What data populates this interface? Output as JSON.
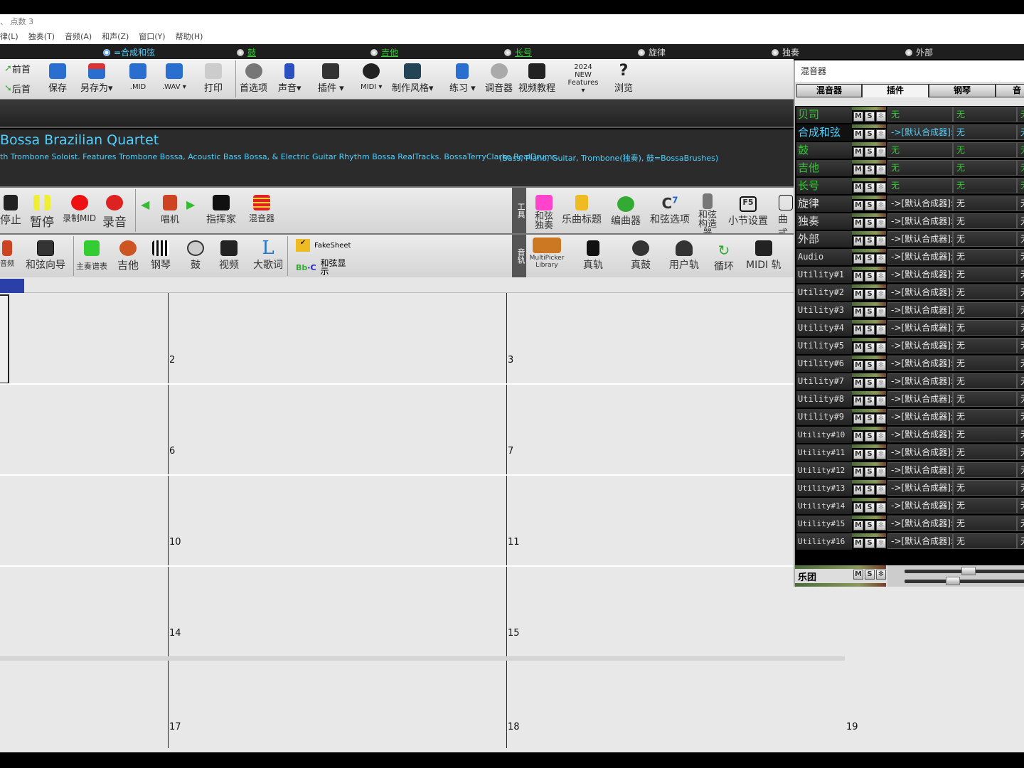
{
  "title_bar": "、 点数 3",
  "menu": [
    "律(L)",
    "独奏(T)",
    "音频(A)",
    "和声(Z)",
    "窗口(Y)",
    "帮助(H)"
  ],
  "tracks": [
    {
      "label": "=合成和弦",
      "selected": true,
      "color": "#4fd0ff"
    },
    {
      "label": "鼓",
      "color": "#3c3"
    },
    {
      "label": "吉他",
      "color": "#3c3"
    },
    {
      "label": "长号",
      "color": "#3c3"
    },
    {
      "label": "旋律",
      "color": "#ddd"
    },
    {
      "label": "独奏",
      "color": "#ddd"
    },
    {
      "label": "外部",
      "color": "#ddd"
    }
  ],
  "toolbar1": {
    "prev": "前首",
    "next": "后首",
    "save": "保存",
    "save_as": "另存为▾",
    "mid": ".MID",
    "wav": ".WAV ▾",
    "print": "打印",
    "prefs": "首选项",
    "sound": "声音▾",
    "plugins": "插件 ▾",
    "midi": "MIDI ▾",
    "make_style": "制作风格▾",
    "practice": "练习 ▾",
    "tuner": "调音器",
    "video_tutorial": "视频教程",
    "new_features": "2024 NEW Features ▾",
    "browse": "浏览"
  },
  "song": {
    "title": "Bossa Brazilian Quartet",
    "description": "th Trombone Soloist. Features Trombone Bossa, Acoustic Bass Bossa, & Electric Guitar Rhythm Bossa RealTracks. BossaTerryClarke RealDrums.",
    "instruments": "(Bass, Piano, Guitar, Trombone(独奏), 鼓=BossaBrushes)"
  },
  "toolbar2": {
    "stop": "停止",
    "pause": "暂停",
    "rec_midi": "录制MID",
    "record": "录音",
    "jukebox": "唱机",
    "conductor": "指挥家",
    "mixer": "混音器",
    "tools_label": "工具",
    "chord_solo": "和弦独奏",
    "song_title": "乐曲标题",
    "sequencer": "编曲器",
    "chord_options": "和弦选项",
    "chord_builder": "和弦构造器",
    "bar_settings": "小节设置",
    "song_form": "曲式"
  },
  "toolbar3": {
    "audio": "音频",
    "chord_wizard": "和弦向导",
    "lead_sheet": "主奏谱表",
    "guitar": "吉他",
    "piano": "钢琴",
    "drums": "鼓",
    "video": "视频",
    "big_lyrics": "大歌词",
    "fakesheet": "FakeSheet",
    "chord_display": "和弦显示",
    "tracks_label": "音轨",
    "multipicker": "MultiPicker Library",
    "realtracks": "真轨",
    "realdrums": "真鼓",
    "user_tracks": "用户轨",
    "loops": "循环",
    "midi_tracks": "MIDI 轨"
  },
  "bars": [
    "2",
    "3",
    "6",
    "7",
    "10",
    "11",
    "14",
    "15",
    "17",
    "18",
    "19"
  ],
  "mixer": {
    "title": "混音器",
    "tabs": [
      "混音器",
      "插件",
      "钢琴",
      "音"
    ],
    "active_tab": 1,
    "rows": [
      {
        "name": "贝司",
        "color": "#3c3",
        "p1": "无",
        "p2": "无",
        "p3": "无"
      },
      {
        "name": "合成和弦",
        "color": "#4fd0ff",
        "p1": "->[默认合成器]:",
        "p2": "无",
        "p3": "无"
      },
      {
        "name": "鼓",
        "color": "#3c3",
        "p1": "无",
        "p2": "无",
        "p3": "无"
      },
      {
        "name": "吉他",
        "color": "#3c3",
        "p1": "无",
        "p2": "无",
        "p3": "无"
      },
      {
        "name": "长号",
        "color": "#3c3",
        "p1": "无",
        "p2": "无",
        "p3": "无"
      },
      {
        "name": "旋律",
        "color": "#ddd",
        "p1": "->[默认合成器]:",
        "p2": "无",
        "p3": "无"
      },
      {
        "name": "独奏",
        "color": "#ddd",
        "p1": "->[默认合成器]:",
        "p2": "无",
        "p3": "无"
      },
      {
        "name": "外部",
        "color": "#ddd",
        "p1": "->[默认合成器]:",
        "p2": "无",
        "p3": "无"
      },
      {
        "name": "Audio",
        "color": "#ddd",
        "p1": "->[默认合成器]:",
        "p2": "无",
        "p3": "无"
      },
      {
        "name": "Utility#1",
        "color": "#ddd",
        "p1": "->[默认合成器]:",
        "p2": "无",
        "p3": "无"
      },
      {
        "name": "Utility#2",
        "color": "#ddd",
        "p1": "->[默认合成器]:",
        "p2": "无",
        "p3": "无"
      },
      {
        "name": "Utility#3",
        "color": "#ddd",
        "p1": "->[默认合成器]:",
        "p2": "无",
        "p3": "无"
      },
      {
        "name": "Utility#4",
        "color": "#ddd",
        "p1": "->[默认合成器]:",
        "p2": "无",
        "p3": "无"
      },
      {
        "name": "Utility#5",
        "color": "#ddd",
        "p1": "->[默认合成器]:",
        "p2": "无",
        "p3": "无"
      },
      {
        "name": "Utility#6",
        "color": "#ddd",
        "p1": "->[默认合成器]:",
        "p2": "无",
        "p3": "无"
      },
      {
        "name": "Utility#7",
        "color": "#ddd",
        "p1": "->[默认合成器]:",
        "p2": "无",
        "p3": "无"
      },
      {
        "name": "Utility#8",
        "color": "#ddd",
        "p1": "->[默认合成器]:",
        "p2": "无",
        "p3": "无"
      },
      {
        "name": "Utility#9",
        "color": "#ddd",
        "p1": "->[默认合成器]:",
        "p2": "无",
        "p3": "无"
      },
      {
        "name": "Utility#10",
        "color": "#ddd",
        "p1": "->[默认合成器]:",
        "p2": "无",
        "p3": "无"
      },
      {
        "name": "Utility#11",
        "color": "#ddd",
        "p1": "->[默认合成器]:",
        "p2": "无",
        "p3": "无"
      },
      {
        "name": "Utility#12",
        "color": "#ddd",
        "p1": "->[默认合成器]:",
        "p2": "无",
        "p3": "无"
      },
      {
        "name": "Utility#13",
        "color": "#ddd",
        "p1": "->[默认合成器]:",
        "p2": "无",
        "p3": "无"
      },
      {
        "name": "Utility#14",
        "color": "#ddd",
        "p1": "->[默认合成器]:",
        "p2": "无",
        "p3": "无"
      },
      {
        "name": "Utility#15",
        "color": "#ddd",
        "p1": "->[默认合成器]:",
        "p2": "无",
        "p3": "无"
      },
      {
        "name": "Utility#16",
        "color": "#ddd",
        "p1": "->[默认合成器]:",
        "p2": "无",
        "p3": "无"
      }
    ],
    "msb": [
      "M",
      "S",
      "✻"
    ],
    "band": "乐团"
  }
}
